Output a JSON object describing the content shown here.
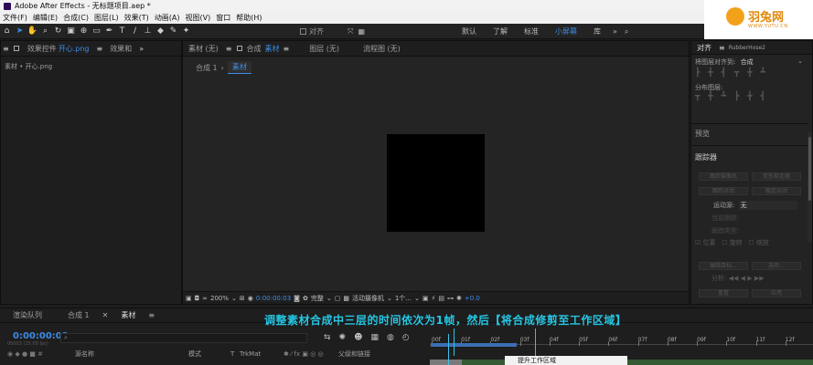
{
  "app": {
    "title": "Adobe After Effects - 无标题项目.aep *"
  },
  "menu": [
    "文件(F)",
    "编辑(E)",
    "合成(C)",
    "图层(L)",
    "效果(T)",
    "动画(A)",
    "视图(V)",
    "窗口",
    "帮助(H)"
  ],
  "toolbar": {
    "tools": [
      "home-icon",
      "selection-arrow-icon",
      "hand-icon",
      "zoom-icon",
      "rotate-icon",
      "camera-icon",
      "pan-behind-icon",
      "rectangle-icon",
      "pen-icon",
      "type-icon",
      "brush-icon",
      "clone-stamp-icon",
      "eraser-icon",
      "roto-brush-icon",
      "puppet-pin-icon"
    ],
    "align_label": "对齐",
    "workspaces": [
      "默认",
      "了解",
      "标准",
      "小屏幕",
      "库"
    ],
    "active_workspace": "小屏幕"
  },
  "logo": {
    "name": "羽兔网",
    "url": "WWW.YUTU.CN"
  },
  "left_panel": {
    "tab_effects_label": "效果控件",
    "tab_effects_file": "开心.png",
    "tab_other": "效果和",
    "subtitle": "素材 • 开心.png"
  },
  "center_panel": {
    "tabs": [
      "素材 (无)",
      "合成",
      "素材",
      "图层 (无)",
      "流程图 (无)"
    ],
    "subtabs": [
      "合成 1",
      "素材"
    ],
    "footer": {
      "zoom": "200%",
      "time": "0:00:00:03",
      "quality": "完整",
      "camera": "活动摄像机",
      "view": "1个...",
      "exposure": "+0.0"
    }
  },
  "right_panel": {
    "tab_align": "对齐",
    "tab_plugin": "RubberHose2",
    "align_to_label": "将图层对齐到:",
    "align_to_value": "合成",
    "distribute_label": "分布图层:",
    "preview_label": "预览",
    "tracker_label": "跟踪器",
    "tracker_buttons": [
      "跟踪摄像机",
      "变形稳定器",
      "跟踪运动",
      "稳定运动"
    ],
    "motion_source_label": "运动源:",
    "motion_source_value": "无",
    "current_track_label": "当前跟踪:",
    "track_type_label": "跟踪类型:",
    "options": [
      "位置",
      "旋转",
      "缩放"
    ],
    "edit_target": "编辑目标...",
    "option_btn": "选项...",
    "analyze_label": "分析:",
    "reset": "重置",
    "apply": "应用"
  },
  "bottom_panel": {
    "tabs": [
      "渲染队列",
      "合成 1",
      "素材"
    ],
    "timecode": "0:00:00:03",
    "timecode_sub": "00003 (25.00 fps)",
    "columns": [
      "源名称",
      "模式",
      "T",
      "TrkMat",
      "父级和链接"
    ],
    "ruler_ticks": [
      "00f",
      "01f",
      "02f",
      "03f",
      "04f",
      "05f",
      "06f",
      "07f",
      "08f",
      "09f",
      "10f",
      "11f",
      "12f"
    ],
    "tooltip": "提升工作区域",
    "caption": "调整素材合成中三层的时间依次为1帧，然后【将合成修剪至工作区域】"
  }
}
